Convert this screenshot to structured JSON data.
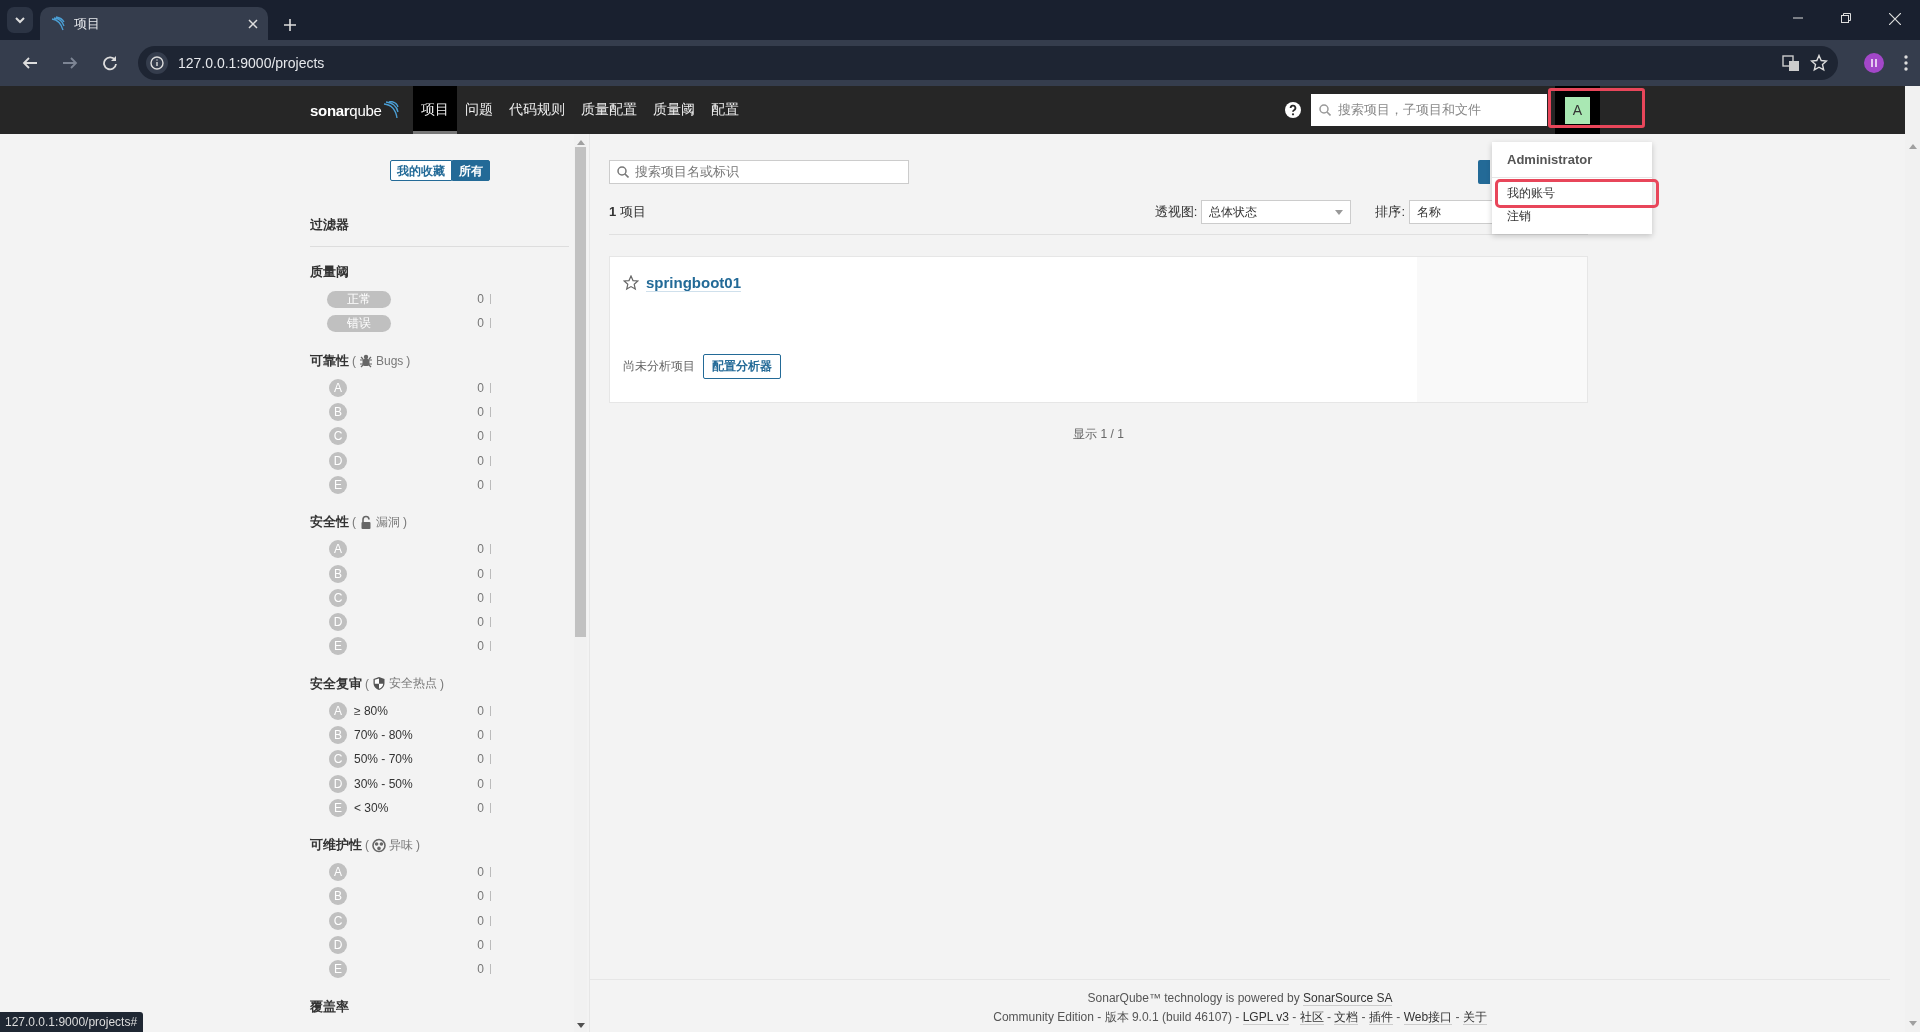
{
  "browser": {
    "tab_title": "项目",
    "url": "127.0.0.1:9000/projects",
    "status_url": "127.0.0.1:9000/projects#"
  },
  "nav": {
    "logo": "**sonar**qube",
    "items": [
      {
        "label": "项目",
        "selected": true
      },
      {
        "label": "问题",
        "selected": false
      },
      {
        "label": "代码规则",
        "selected": false
      },
      {
        "label": "质量配置",
        "selected": false
      },
      {
        "label": "质量阈",
        "selected": false
      },
      {
        "label": "配置",
        "selected": false
      }
    ],
    "search_placeholder": "搜索项目，子项目和文件",
    "avatar": "A",
    "avatar_highlighted": true
  },
  "user_menu": {
    "user": "Administrator",
    "items": [
      {
        "label": "我的账号",
        "highlighted": true
      },
      {
        "label": "注销",
        "highlighted": false
      }
    ]
  },
  "sidebar": {
    "toggle": [
      {
        "label": "我的收藏",
        "selected": false
      },
      {
        "label": "所有",
        "selected": true
      }
    ],
    "filters_title": "过滤器",
    "sections": [
      {
        "kind": "quality_gate",
        "title": "质量阈",
        "rows": [
          {
            "label": "正常",
            "count": "0"
          },
          {
            "label": "错误",
            "count": "0"
          }
        ]
      },
      {
        "kind": "reliability",
        "title": "可靠性",
        "paren_open": "(",
        "note": "Bugs",
        "paren_close": ")",
        "rows": [
          {
            "label": "A",
            "count": "0"
          },
          {
            "label": "B",
            "count": "0"
          },
          {
            "label": "C",
            "count": "0"
          },
          {
            "label": "D",
            "count": "0"
          },
          {
            "label": "E",
            "count": "0"
          }
        ]
      },
      {
        "kind": "security",
        "title": "安全性",
        "paren_open": "(",
        "note": "漏洞",
        "paren_close": ")",
        "rows": [
          {
            "label": "A",
            "count": "0"
          },
          {
            "label": "B",
            "count": "0"
          },
          {
            "label": "C",
            "count": "0"
          },
          {
            "label": "D",
            "count": "0"
          },
          {
            "label": "E",
            "count": "0"
          }
        ]
      },
      {
        "kind": "security_review",
        "title": "安全复审",
        "paren_open": "(",
        "note": "安全热点",
        "paren_close": ")",
        "rows": [
          {
            "label": "A",
            "range": "≥ 80%",
            "count": "0"
          },
          {
            "label": "B",
            "range": "70% - 80%",
            "count": "0"
          },
          {
            "label": "C",
            "range": "50% - 70%",
            "count": "0"
          },
          {
            "label": "D",
            "range": "30% - 50%",
            "count": "0"
          },
          {
            "label": "E",
            "range": "< 30%",
            "count": "0"
          }
        ]
      },
      {
        "kind": "maintainability",
        "title": "可维护性",
        "paren_open": "(",
        "note": "异味",
        "paren_close": ")",
        "rows": [
          {
            "label": "A",
            "count": "0"
          },
          {
            "label": "B",
            "count": "0"
          },
          {
            "label": "C",
            "count": "0"
          },
          {
            "label": "D",
            "count": "0"
          },
          {
            "label": "E",
            "count": "0"
          }
        ]
      },
      {
        "kind": "heading",
        "title": "覆盖率"
      }
    ]
  },
  "main": {
    "search_placeholder": "搜索项目名或标识",
    "count": "**1** 项目",
    "perspective_label": "透视图:",
    "perspective_value": "总体状态",
    "sort_label": "排序:",
    "sort_value": "名称",
    "project": {
      "name": "springboot01",
      "favorite": false,
      "status": "尚未分析项目",
      "action": "配置分析器"
    },
    "pagination": "显示 1 / 1"
  },
  "footer": {
    "lines": [
      [
        {
          "text": "SonarQube™ technology is powered by ",
          "kind": "text"
        },
        {
          "text": "SonarSource SA",
          "kind": "link"
        }
      ],
      [
        {
          "text": "Community Edition - 版本 9.0.1 (build 46107) - ",
          "kind": "text"
        },
        {
          "text": "LGPL v3",
          "kind": "link"
        },
        {
          "text": " - ",
          "kind": "text"
        },
        {
          "text": "社区",
          "kind": "link"
        },
        {
          "text": " - ",
          "kind": "text"
        },
        {
          "text": "文档",
          "kind": "link"
        },
        {
          "text": " - ",
          "kind": "text"
        },
        {
          "text": "插件",
          "kind": "link"
        },
        {
          "text": " - ",
          "kind": "text"
        },
        {
          "text": "Web接口",
          "kind": "link"
        },
        {
          "text": " - ",
          "kind": "text"
        },
        {
          "text": "关于",
          "kind": "link"
        }
      ]
    ]
  }
}
